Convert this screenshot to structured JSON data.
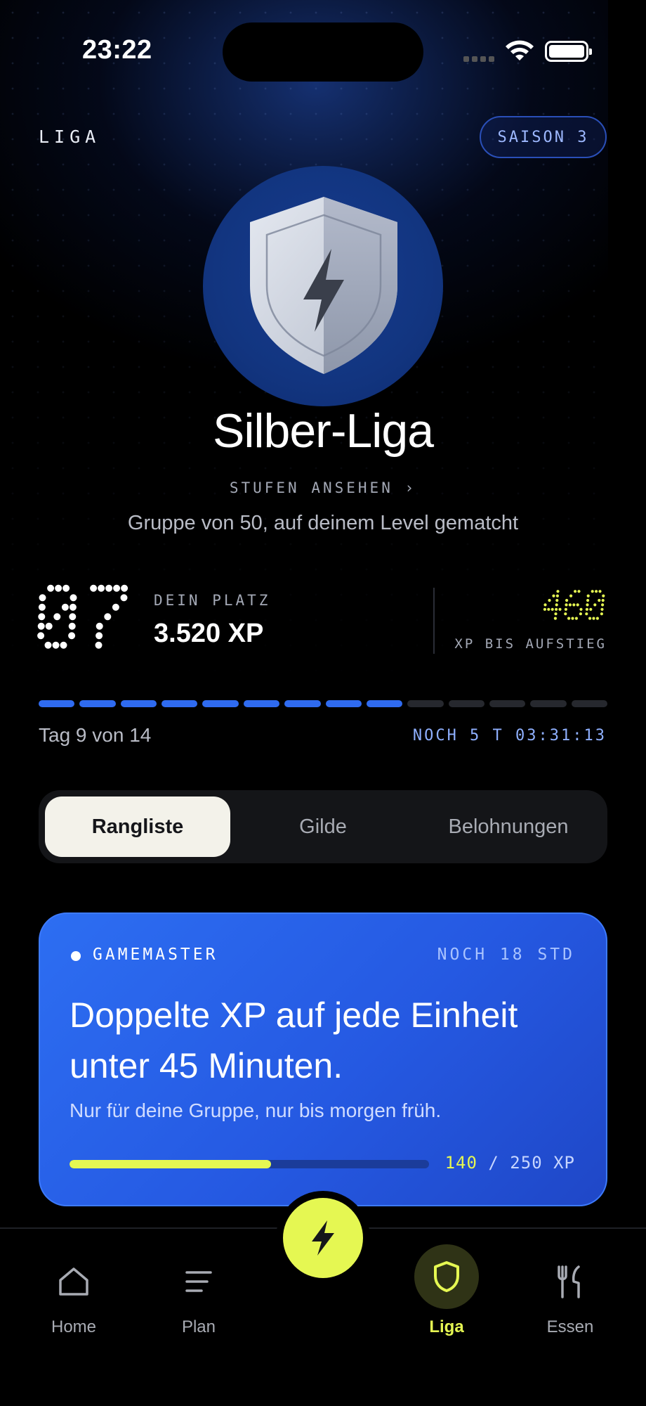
{
  "status_bar": {
    "time": "23:22"
  },
  "header": {
    "section_label": "LIGA",
    "season_badge": "SAISON 3"
  },
  "league": {
    "name": "Silber-Liga",
    "levels_link": "STUFEN ANSEHEN ›",
    "group_info": "Gruppe von 50, auf deinem Level gematcht"
  },
  "rank": {
    "position": "07",
    "position_label": "DEIN PLATZ",
    "xp": "3.520 XP",
    "xp_to_promotion": "460",
    "xp_to_promotion_label": "XP BIS AUFSTIEG"
  },
  "season_progress": {
    "days_done": 9,
    "days_total": 14,
    "day_label": "Tag 9 von 14",
    "countdown": "NOCH 5 T 03:31:13"
  },
  "tabs": [
    {
      "label": "Rangliste",
      "active": true
    },
    {
      "label": "Gilde",
      "active": false
    },
    {
      "label": "Belohnungen",
      "active": false
    }
  ],
  "gamemaster_card": {
    "tag": "GAMEMASTER",
    "remaining": "NOCH 18 STD",
    "title": "Doppelte XP auf jede Einheit unter 45 Minuten.",
    "subtitle": "Nur für deine Gruppe, nur bis morgen früh.",
    "progress_current": "140",
    "progress_rest": " / 250 XP",
    "progress_fraction": 0.56
  },
  "bottom_nav": [
    {
      "label": "Home",
      "icon": "home-icon",
      "active": false
    },
    {
      "label": "Plan",
      "icon": "plan-icon",
      "active": false
    },
    {
      "label": "Liga",
      "icon": "shield-icon",
      "active": true
    },
    {
      "label": "Essen",
      "icon": "fork-knife-icon",
      "active": false
    }
  ],
  "fab": {
    "icon": "bolt-icon"
  },
  "colors": {
    "accent": "#e5f752",
    "primary_blue": "#2f6bf0",
    "card_blue": "#2559e2",
    "background": "#000000"
  }
}
